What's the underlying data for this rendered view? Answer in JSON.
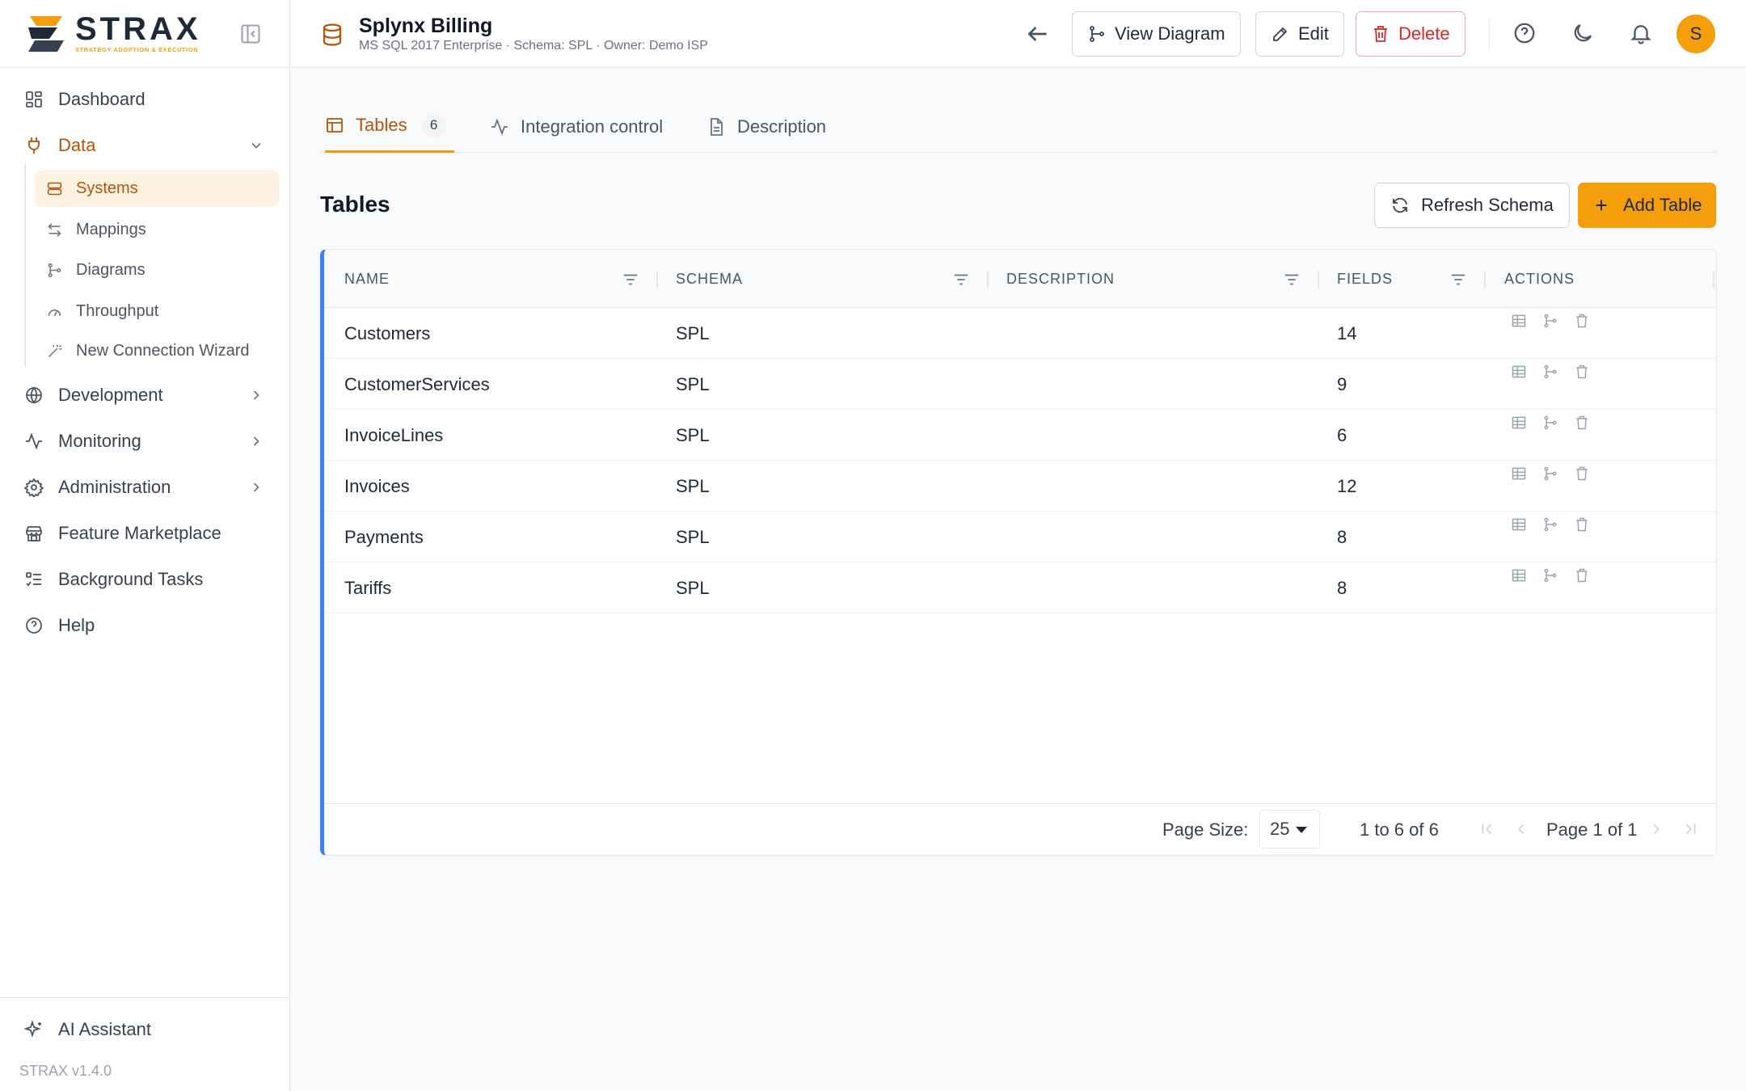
{
  "brand": {
    "name": "STRAX",
    "tagline": "STRATEGY ADOPTION & EXECUTION",
    "version": "STRAX v1.4.0"
  },
  "colors": {
    "accent": "#f59e0b",
    "accent_dark": "#b45309",
    "danger": "#dc2626",
    "grid_border": "#3b82f6"
  },
  "sidebar": {
    "items": [
      {
        "label": "Dashboard",
        "icon": "dashboard-icon"
      },
      {
        "label": "Data",
        "icon": "plug-icon",
        "expanded": true
      },
      {
        "label": "Development",
        "icon": "globe-icon"
      },
      {
        "label": "Monitoring",
        "icon": "activity-icon"
      },
      {
        "label": "Administration",
        "icon": "gear-icon"
      },
      {
        "label": "Feature Marketplace",
        "icon": "store-icon"
      },
      {
        "label": "Background Tasks",
        "icon": "list-tasks-icon"
      },
      {
        "label": "Help",
        "icon": "help-icon"
      }
    ],
    "data_subitems": [
      {
        "label": "Systems",
        "icon": "server-icon",
        "active": true
      },
      {
        "label": "Mappings",
        "icon": "arrows-icon"
      },
      {
        "label": "Diagrams",
        "icon": "diagram-icon"
      },
      {
        "label": "Throughput",
        "icon": "gauge-icon"
      },
      {
        "label": "New Connection Wizard",
        "icon": "wand-icon"
      }
    ],
    "footer": {
      "label": "AI Assistant",
      "icon": "sparkles-icon"
    }
  },
  "header": {
    "title": "Splynx Billing",
    "subtitle": "MS SQL 2017 Enterprise · Schema: SPL · Owner: Demo ISP",
    "view_diagram_label": "View Diagram",
    "edit_label": "Edit",
    "delete_label": "Delete",
    "avatar_initial": "S"
  },
  "tabs": [
    {
      "label": "Tables",
      "count": "6",
      "active": true
    },
    {
      "label": "Integration control"
    },
    {
      "label": "Description"
    }
  ],
  "section": {
    "title": "Tables",
    "refresh_label": "Refresh Schema",
    "add_label": "Add Table"
  },
  "table": {
    "columns": [
      "NAME",
      "SCHEMA",
      "DESCRIPTION",
      "FIELDS",
      "ACTIONS"
    ],
    "rows": [
      {
        "name": "Customers",
        "schema": "SPL",
        "description": "",
        "fields": "14"
      },
      {
        "name": "CustomerServices",
        "schema": "SPL",
        "description": "",
        "fields": "9"
      },
      {
        "name": "InvoiceLines",
        "schema": "SPL",
        "description": "",
        "fields": "6"
      },
      {
        "name": "Invoices",
        "schema": "SPL",
        "description": "",
        "fields": "12"
      },
      {
        "name": "Payments",
        "schema": "SPL",
        "description": "",
        "fields": "8"
      },
      {
        "name": "Tariffs",
        "schema": "SPL",
        "description": "",
        "fields": "8"
      }
    ]
  },
  "pagination": {
    "page_size_label": "Page Size:",
    "page_size": "25",
    "range": "1 to 6 of 6",
    "page": "Page 1 of 1"
  }
}
